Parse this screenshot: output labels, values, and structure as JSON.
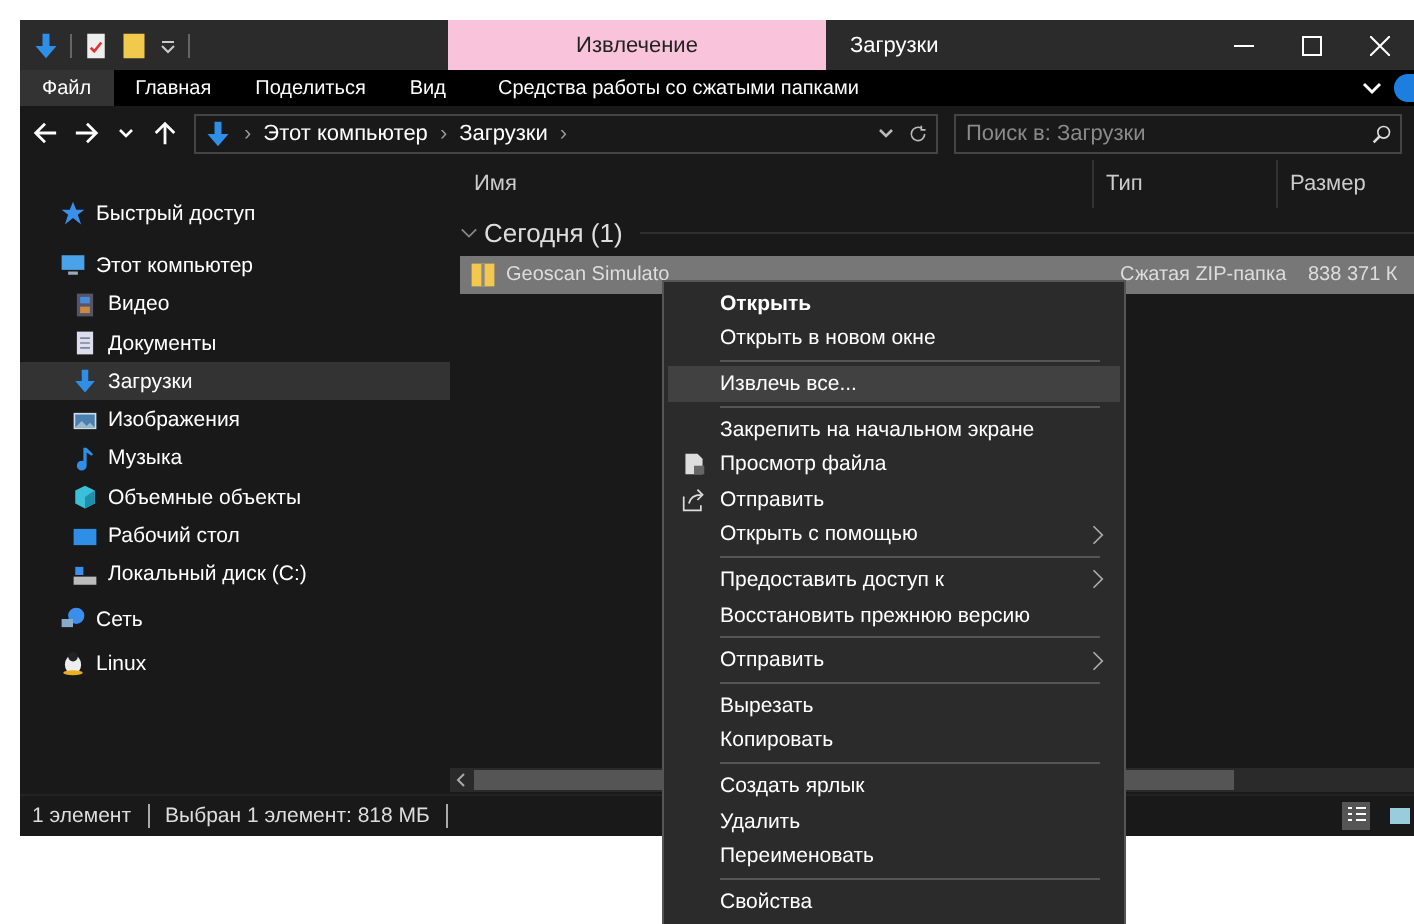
{
  "window": {
    "title": "Загрузки",
    "context_tab": "Извлечение"
  },
  "ribbon_tabs": [
    {
      "label": "Файл",
      "selected": true
    },
    {
      "label": "Главная",
      "selected": false
    },
    {
      "label": "Поделиться",
      "selected": false
    },
    {
      "label": "Вид",
      "selected": false
    },
    {
      "label": "Средства работы со сжатыми папками",
      "selected": false
    }
  ],
  "address_bar": {
    "path": [
      "Этот компьютер",
      "Загрузки"
    ],
    "separator": "›"
  },
  "search": {
    "placeholder": "Поиск в: Загрузки"
  },
  "nav": [
    {
      "label": "Быстрый доступ",
      "kind": "star",
      "selected": false
    },
    {
      "label": "Этот компьютер",
      "kind": "computer",
      "selected": false,
      "children": [
        {
          "label": "Видео",
          "kind": "video",
          "selected": false
        },
        {
          "label": "Документы",
          "kind": "documents",
          "selected": false
        },
        {
          "label": "Загрузки",
          "kind": "download",
          "selected": true
        },
        {
          "label": "Изображения",
          "kind": "pictures",
          "selected": false
        },
        {
          "label": "Музыка",
          "kind": "music",
          "selected": false
        },
        {
          "label": "Объемные объекты",
          "kind": "objects",
          "selected": false
        },
        {
          "label": "Рабочий стол",
          "kind": "desktop",
          "selected": false
        },
        {
          "label": "Локальный диск (C:)",
          "kind": "drive",
          "selected": false
        }
      ]
    },
    {
      "label": "Сеть",
      "kind": "network",
      "selected": false
    },
    {
      "label": "Linux",
      "kind": "linux",
      "selected": false
    }
  ],
  "table": {
    "columns": [
      "Имя",
      "Тип",
      "Размер"
    ],
    "group": {
      "label": "Сегодня (1)",
      "expanded": true
    },
    "rows": [
      {
        "name": "Geoscan Simulato",
        "type": "Сжатая ZIP-папка",
        "size": "838 371 К",
        "selected": true
      }
    ]
  },
  "status_bar": {
    "count": "1 элемент",
    "selection": "Выбран 1 элемент: 818 МБ",
    "views": [
      {
        "kind": "details",
        "selected": true
      },
      {
        "kind": "icons",
        "selected": false
      }
    ]
  },
  "context_menu": [
    {
      "kind": "item",
      "label": "Открыть",
      "bold": true,
      "highlighted": false,
      "submenu": false
    },
    {
      "kind": "item",
      "label": "Открыть в новом окне",
      "bold": false,
      "highlighted": false,
      "submenu": false
    },
    {
      "kind": "separator"
    },
    {
      "kind": "item",
      "label": "Извлечь все...",
      "bold": false,
      "highlighted": true,
      "submenu": false
    },
    {
      "kind": "separator"
    },
    {
      "kind": "item",
      "label": "Закрепить на начальном экране",
      "bold": false,
      "highlighted": false,
      "submenu": false
    },
    {
      "kind": "preview",
      "label": "Просмотр файла",
      "bold": false,
      "highlighted": false,
      "submenu": false
    },
    {
      "kind": "share",
      "label": "Отправить",
      "bold": false,
      "highlighted": false,
      "submenu": false
    },
    {
      "kind": "item",
      "label": "Открыть с помощью",
      "bold": false,
      "highlighted": false,
      "submenu": true
    },
    {
      "kind": "separator"
    },
    {
      "kind": "item",
      "label": "Предоставить доступ к",
      "bold": false,
      "highlighted": false,
      "submenu": true
    },
    {
      "kind": "item",
      "label": "Восстановить прежнюю версию",
      "bold": false,
      "highlighted": false,
      "submenu": false
    },
    {
      "kind": "separator"
    },
    {
      "kind": "item",
      "label": "Отправить",
      "bold": false,
      "highlighted": false,
      "submenu": true
    },
    {
      "kind": "separator"
    },
    {
      "kind": "item",
      "label": "Вырезать",
      "bold": false,
      "highlighted": false,
      "submenu": false
    },
    {
      "kind": "item",
      "label": "Копировать",
      "bold": false,
      "highlighted": false,
      "submenu": false
    },
    {
      "kind": "separator"
    },
    {
      "kind": "item",
      "label": "Создать ярлык",
      "bold": false,
      "highlighted": false,
      "submenu": false
    },
    {
      "kind": "item",
      "label": "Удалить",
      "bold": false,
      "highlighted": false,
      "submenu": false
    },
    {
      "kind": "item",
      "label": "Переименовать",
      "bold": false,
      "highlighted": false,
      "submenu": false
    },
    {
      "kind": "separator"
    },
    {
      "kind": "item",
      "label": "Свойства",
      "bold": false,
      "highlighted": false,
      "submenu": false
    }
  ]
}
